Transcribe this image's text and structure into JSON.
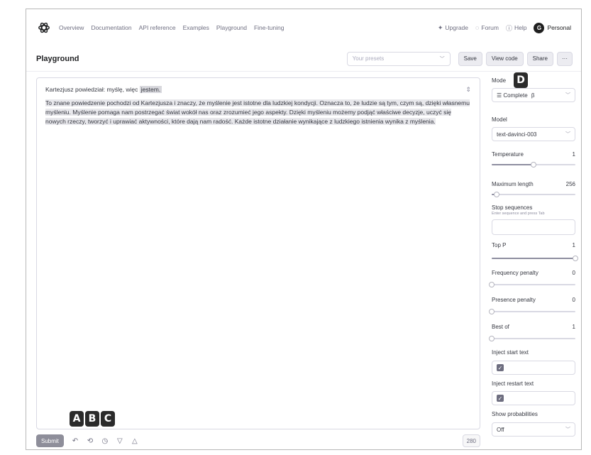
{
  "nav": {
    "links": [
      "Overview",
      "Documentation",
      "API reference",
      "Examples",
      "Playground",
      "Fine-tuning"
    ],
    "upgrade": "Upgrade",
    "forum": "Forum",
    "help": "Help",
    "avatar_initial": "G",
    "account": "Personal"
  },
  "toolbar": {
    "title": "Playground",
    "preset_placeholder": "Your presets",
    "save": "Save",
    "view_code": "View code",
    "share": "Share",
    "more": "···"
  },
  "editor": {
    "prompt_prefix": "Kartezjusz powiedział: myślę, więc ",
    "prompt_highlight": "jestem.",
    "completion": "To znane powiedzenie pochodzi od Kartezjusza i znaczy, że myślenie jest istotne dla ludzkiej kondycji. Oznacza to, że ludzie są tym, czym są, dzięki własnemu myśleniu. Myślenie pomaga nam postrzegać świat wokół nas oraz zrozumieć jego aspekty. Dzięki myśleniu możemy podjąć właściwe decyzje, uczyć się nowych rzeczy, tworzyć i uprawiać aktywności, które dają nam radość. Każde istotne działanie wynikające z ludzkiego istnienia wynika z myślenia."
  },
  "bottom": {
    "submit": "Submit",
    "token_count": "280"
  },
  "callouts": [
    "A",
    "B",
    "C",
    "D"
  ],
  "sidebar": {
    "mode_label": "Mode",
    "mode_value": "Complete",
    "mode_badge": "β",
    "model_label": "Model",
    "model_value": "text-davinci-003",
    "temperature_label": "Temperature",
    "temperature_value": "1",
    "temperature_fraction": 0.5,
    "max_length_label": "Maximum length",
    "max_length_value": "256",
    "max_length_fraction": 0.06,
    "stop_label": "Stop sequences",
    "stop_hint": "Enter sequence and press Tab",
    "top_p_label": "Top P",
    "top_p_value": "1",
    "top_p_fraction": 1.0,
    "freq_label": "Frequency penalty",
    "freq_value": "0",
    "freq_fraction": 0.0,
    "presence_label": "Presence penalty",
    "presence_value": "0",
    "presence_fraction": 0.0,
    "best_of_label": "Best of",
    "best_of_value": "1",
    "best_of_fraction": 0.0,
    "inject_start_label": "Inject start text",
    "inject_start_checked": true,
    "inject_restart_label": "Inject restart text",
    "inject_restart_checked": true,
    "probabilities_label": "Show probabilities",
    "probabilities_value": "Off"
  }
}
